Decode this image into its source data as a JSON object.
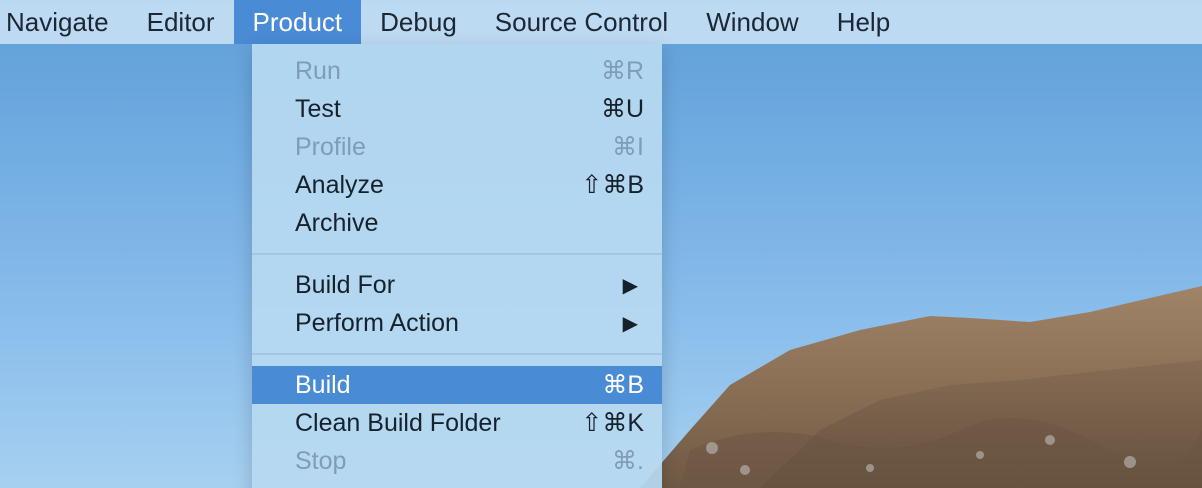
{
  "menubar": {
    "items": [
      {
        "label": "Navigate",
        "active": false
      },
      {
        "label": "Editor",
        "active": false
      },
      {
        "label": "Product",
        "active": true
      },
      {
        "label": "Debug",
        "active": false
      },
      {
        "label": "Source Control",
        "active": false
      },
      {
        "label": "Window",
        "active": false
      },
      {
        "label": "Help",
        "active": false
      }
    ]
  },
  "product_menu": {
    "groups": [
      [
        {
          "label": "Run",
          "shortcut": "⌘R",
          "disabled": true
        },
        {
          "label": "Test",
          "shortcut": "⌘U",
          "disabled": false
        },
        {
          "label": "Profile",
          "shortcut": "⌘I",
          "disabled": true
        },
        {
          "label": "Analyze",
          "shortcut": "⇧⌘B",
          "disabled": false
        },
        {
          "label": "Archive",
          "shortcut": "",
          "disabled": false
        }
      ],
      [
        {
          "label": "Build For",
          "submenu": true,
          "submenu_icon": "triangle-right-icon"
        },
        {
          "label": "Perform Action",
          "submenu": true,
          "submenu_icon": "triangle-right-icon"
        }
      ],
      [
        {
          "label": "Build",
          "shortcut": "⌘B",
          "highlighted": true
        },
        {
          "label": "Clean Build Folder",
          "shortcut": "⇧⌘K",
          "disabled": false
        },
        {
          "label": "Stop",
          "shortcut": "⌘.",
          "disabled": true
        }
      ]
    ]
  },
  "colors": {
    "highlight": "#4a8bd6",
    "menu_text": "#16212c",
    "disabled_text": "#7f9cb8"
  }
}
